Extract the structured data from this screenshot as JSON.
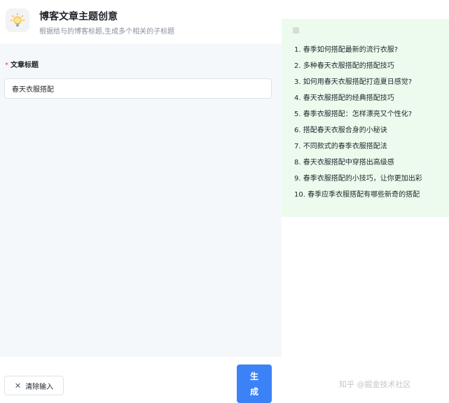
{
  "header": {
    "title": "博客文章主题创意",
    "subtitle": "根据给与的博客标题,生成多个相关的子标题",
    "icon": "lightbulb-icon"
  },
  "form": {
    "required_mark": "*",
    "label": "文章标题",
    "value": "春天衣服搭配"
  },
  "footer": {
    "clear_label": "清除输入",
    "generate_label": "生成"
  },
  "results": [
    "1. 春季如何搭配最新的流行衣服?",
    "2. 多种春天衣服搭配的搭配技巧",
    "3. 如何用春天衣服搭配打造夏日感觉?",
    "4. 春天衣服搭配的经典搭配技巧",
    "5. 春季衣服搭配：怎样漂亮又个性化?",
    "6. 搭配春天衣服合身的小秘诀",
    "7. 不同款式的春季衣服搭配法",
    "8. 春天衣服搭配中穿搭出高级感",
    "9. 春季衣服搭配的小技巧，让你更加出彩",
    "10. 春季应季衣服搭配有哪些新奇的搭配"
  ],
  "watermark": "知乎 @掘金技术社区",
  "colors": {
    "accent": "#3b82f6",
    "result_bg": "#ecfbee",
    "required": "#f53f3f"
  }
}
